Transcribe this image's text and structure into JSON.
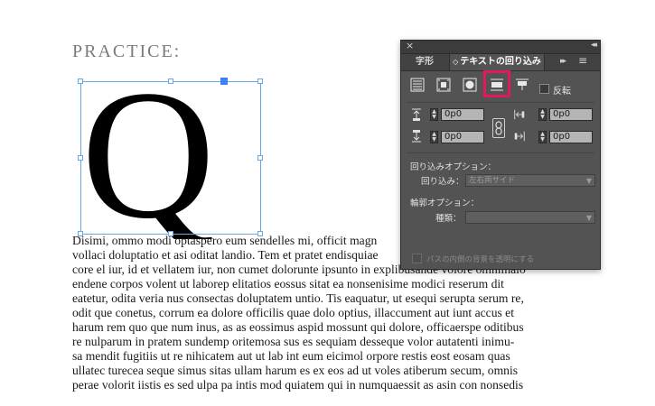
{
  "document": {
    "heading": "PRACTICE:",
    "drop_cap": "Q",
    "lines": [
      "Disimi, ommo modi optaspero eum sendelles mi, officit magn",
      "vollaci doluptatio et asi oditat landio. Tem et pratet endisquiae",
      "core el iur, id et vellatem iur, non cumet dolorunte ipsunto in explibusande volore omnimaio",
      "endene corpos volent ut laborep elitatios eossus sitat ea nonsenisime modici reserum dit",
      "eatetur, odita veria nus consectas doluptatem untio. Tis eaquatur, ut esequi serupta serum re,",
      "odit que conetus, corrum ea dolore officilis quae dolo optius, illaccument aut iunt accus et",
      "harum rem quo que num inus, as as eossimus aspid mossunt qui dolore, officaerspe oditibus",
      "re nulparum in pratem sundemp oritemosa sus es sequiam desseque volor autatenti inimu-",
      "sa mendit fugitiis ut re nihicatem aut ut lab int eum eicimol orpore restis eost eosam quas",
      "ullatec turecea seque simus sitas ullam harum es ex eos ad ut voles atiberum secum, omnis",
      "perae volorit iistis es sed ulpa pa intis mod quiatem qui in numquaessit as asin con nonsedis"
    ]
  },
  "panel": {
    "close": "×",
    "collapse": "◂◂",
    "tabs": [
      {
        "label": "字形"
      },
      {
        "label": "テキストの回り込み",
        "chevron": "◇"
      }
    ],
    "more": "▸▸",
    "menu": "≡",
    "invert_label": "反転",
    "offsets": {
      "top": "0p0",
      "bottom": "0p0",
      "left": "0p0",
      "right": "0p0"
    },
    "wrap_options_heading": "回り込みオプション：",
    "wrap_to_label": "回り込み：",
    "wrap_to_value": "左右両サイド",
    "contour_heading": "輪郭オプション：",
    "type_label": "種類：",
    "type_value": "",
    "include_inside_label": "パスの内側の背景を透明にする",
    "colors": {
      "highlight": "#e2195a",
      "selection": "#6aa7e6"
    }
  }
}
